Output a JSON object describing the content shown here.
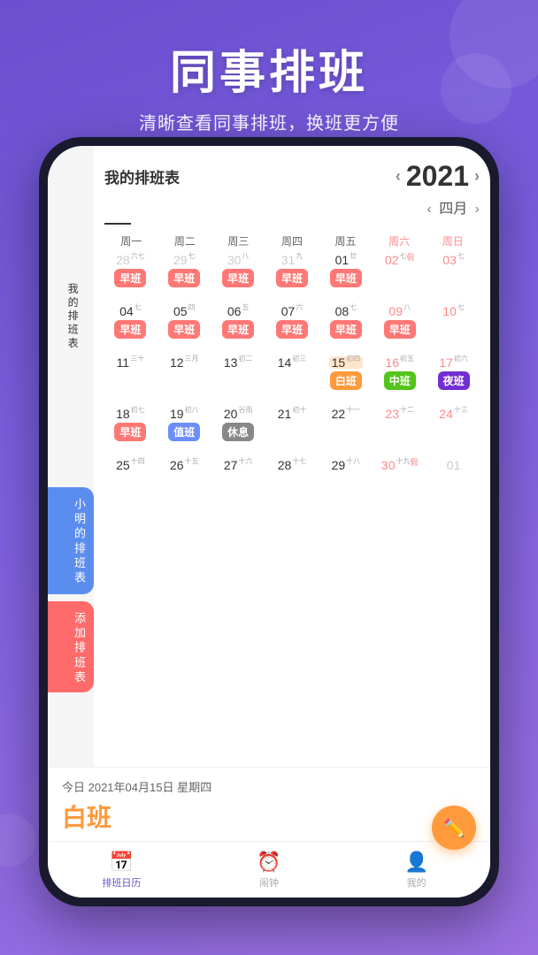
{
  "header": {
    "main_title": "同事排班",
    "sub_title": "清晰查看同事排班，换班更方便"
  },
  "sidebar": {
    "tab1_label": "我\n的\n排\n班\n表",
    "tab2_label": "小\n明\n的\n排\n班\n表",
    "tab3_label": "添\n加\n排\n班\n表"
  },
  "calendar": {
    "title": "我的排班表",
    "year": "2021",
    "month": "四月",
    "arrow_left": "‹",
    "arrow_right": "›",
    "day_headers": [
      "周一",
      "周二",
      "周三",
      "周四",
      "周五",
      "周六",
      "周日"
    ],
    "weeks": [
      [
        {
          "date": "28",
          "lunar": "六七",
          "shift": "早班",
          "shift_type": "early",
          "other": true
        },
        {
          "date": "29",
          "lunar": "七",
          "shift": "早班",
          "shift_type": "early",
          "other": true
        },
        {
          "date": "30",
          "lunar": "八",
          "shift": "早班",
          "shift_type": "early",
          "other": true
        },
        {
          "date": "31",
          "lunar": "九",
          "shift": "早班",
          "shift_type": "early",
          "other": true
        },
        {
          "date": "01",
          "lunar": "廿",
          "shift": "早班",
          "shift_type": "early"
        },
        {
          "date": "02",
          "lunar": "七",
          "holiday": "假",
          "shift": "",
          "shift_type": "",
          "weekend": true
        },
        {
          "date": "03",
          "lunar": "七",
          "shift": "",
          "shift_type": "",
          "weekend": true
        }
      ],
      [
        {
          "date": "04",
          "lunar": "七",
          "shift": "早班",
          "shift_type": "early"
        },
        {
          "date": "05",
          "lunar": "四",
          "shift": "早班",
          "shift_type": "early"
        },
        {
          "date": "06",
          "lunar": "五",
          "shift": "早班",
          "shift_type": "early"
        },
        {
          "date": "07",
          "lunar": "六",
          "shift": "早班",
          "shift_type": "early"
        },
        {
          "date": "08",
          "lunar": "七",
          "shift": "早班",
          "shift_type": "early"
        },
        {
          "date": "09",
          "lunar": "八",
          "shift": "早班",
          "shift_type": "early",
          "weekend": true
        },
        {
          "date": "10",
          "lunar": "七",
          "shift": "",
          "shift_type": "",
          "weekend": true
        }
      ],
      [
        {
          "date": "11",
          "lunar": "三十",
          "shift": "",
          "shift_type": ""
        },
        {
          "date": "12",
          "lunar": "三月",
          "shift": "",
          "shift_type": ""
        },
        {
          "date": "13",
          "lunar": "初二",
          "shift": "",
          "shift_type": ""
        },
        {
          "date": "14",
          "lunar": "初三",
          "shift": "",
          "shift_type": ""
        },
        {
          "date": "15",
          "lunar": "初四",
          "shift": "白班",
          "shift_type": "white",
          "today": true
        },
        {
          "date": "16",
          "lunar": "初五",
          "shift": "中班",
          "shift_type": "mid",
          "weekend": true
        },
        {
          "date": "17",
          "lunar": "初六",
          "shift": "夜班",
          "shift_type": "night",
          "weekend": true
        }
      ],
      [
        {
          "date": "18",
          "lunar": "初七",
          "shift": "早班",
          "shift_type": "early"
        },
        {
          "date": "19",
          "lunar": "初八",
          "shift": "值班",
          "shift_type": "value"
        },
        {
          "date": "20",
          "lunar": "谷雨",
          "shift": "休息",
          "shift_type": "rest"
        },
        {
          "date": "21",
          "lunar": "初十",
          "shift": "",
          "shift_type": ""
        },
        {
          "date": "22",
          "lunar": "十一",
          "shift": "",
          "shift_type": ""
        },
        {
          "date": "23",
          "lunar": "十二",
          "shift": "",
          "shift_type": "",
          "weekend": true
        },
        {
          "date": "24",
          "lunar": "十三",
          "shift": "",
          "shift_type": "",
          "weekend": true
        }
      ],
      [
        {
          "date": "25",
          "lunar": "十四",
          "shift": "",
          "shift_type": ""
        },
        {
          "date": "26",
          "lunar": "十五",
          "shift": "",
          "shift_type": ""
        },
        {
          "date": "27",
          "lunar": "十六",
          "shift": "",
          "shift_type": ""
        },
        {
          "date": "28",
          "lunar": "十七",
          "shift": "",
          "shift_type": ""
        },
        {
          "date": "29",
          "lunar": "十八",
          "shift": "",
          "shift_type": ""
        },
        {
          "date": "30",
          "lunar": "十九",
          "holiday": "假",
          "shift": "",
          "shift_type": "",
          "weekend": true
        },
        {
          "date": "01",
          "lunar": "",
          "shift": "",
          "shift_type": "",
          "weekend": true,
          "other": true
        }
      ]
    ]
  },
  "bottom_info": {
    "today_label": "今日  2021年04月15日  星期四",
    "shift_name": "白班"
  },
  "nav": {
    "items": [
      {
        "label": "排班日历",
        "icon": "📅",
        "active": true
      },
      {
        "label": "闹钟",
        "icon": "⏰",
        "active": false
      },
      {
        "label": "我的",
        "icon": "👤",
        "active": false
      }
    ]
  },
  "fab_icon": "✏️"
}
